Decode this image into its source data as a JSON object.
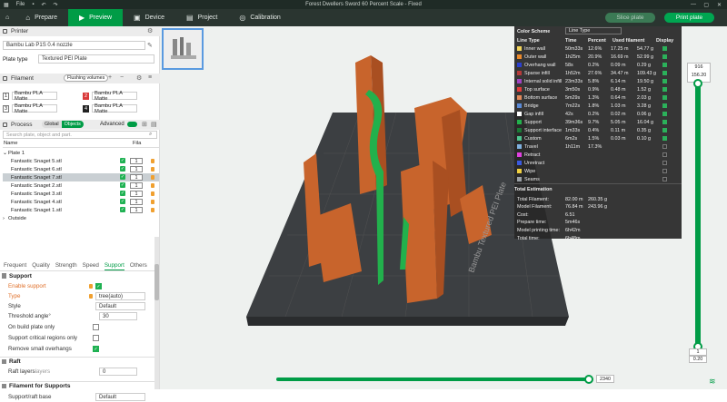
{
  "window": {
    "menu": "File",
    "title": "Forest Dwellers Sword 60 Percent Scale - Fixed"
  },
  "tabs": [
    {
      "icon": "⌂",
      "label": "Prepare"
    },
    {
      "icon": "▶",
      "label": "Preview"
    },
    {
      "icon": "▣",
      "label": "Device"
    },
    {
      "icon": "▤",
      "label": "Project"
    },
    {
      "icon": "◎",
      "label": "Calibration"
    }
  ],
  "actions": {
    "slice": "Slice plate",
    "print": "Print plate"
  },
  "printer": {
    "section": "Printer",
    "name": "Bambu Lab P1S 0.4 nozzle",
    "plate_type_label": "Plate type",
    "plate_type": "Textured PEI Plate"
  },
  "filament": {
    "section": "Filament",
    "flushing": "Flushing volumes",
    "slots": [
      {
        "n": "1",
        "name": "Bambu PLA Matte",
        "style": "white"
      },
      {
        "n": "2",
        "name": "Bambu PLA Matte",
        "style": "red"
      },
      {
        "n": "3",
        "name": "Bambu PLA Matte",
        "style": "white"
      },
      {
        "n": "4",
        "name": "Bambu PLA Matte",
        "style": "blk"
      }
    ]
  },
  "process": {
    "section": "Process",
    "global": "Global",
    "objects": "Objects",
    "advanced": "Advanced",
    "search_placeholder": "Search plate, object and part.",
    "col_name": "Name",
    "col_fila": "Fila"
  },
  "tree": {
    "plate": "Plate 1",
    "items": [
      {
        "name": "Fantastic Snaget 5.stl",
        "fila": "1"
      },
      {
        "name": "Fantastic Snaget 6.stl",
        "fila": "1"
      },
      {
        "name": "Fantastic Snaget 7.stl",
        "fila": "1"
      },
      {
        "name": "Fantastic Snaget 2.stl",
        "fila": "1"
      },
      {
        "name": "Fantastic Snaget 3.stl",
        "fila": "1"
      },
      {
        "name": "Fantastic Snaget 4.stl",
        "fila": "1"
      },
      {
        "name": "Fantastic Snaget 1.stl",
        "fila": "1"
      }
    ],
    "outside": "Outside"
  },
  "param_tabs": [
    "Frequent",
    "Quality",
    "Strength",
    "Speed",
    "Support",
    "Others"
  ],
  "support": {
    "header": "Support",
    "enable": "Enable support",
    "type_label": "Type",
    "type_value": "tree(auto)",
    "style_label": "Style",
    "style_value": "Default",
    "threshold_label": "Threshold angle",
    "threshold_value": "30",
    "threshold_unit": "°",
    "on_build_plate": "On build plate only",
    "critical": "Support critical regions only",
    "remove_small": "Remove small overhangs"
  },
  "raft": {
    "header": "Raft",
    "layers_label": "Raft layers",
    "layers_value": "0",
    "layers_unit": "layers"
  },
  "filament_support": {
    "header": "Filament for Supports",
    "base_label": "Support/raft base",
    "base_value": "Default"
  },
  "legend": {
    "title": "Color Scheme",
    "scheme": "Line Type",
    "headers": [
      "Line Type",
      "Time",
      "Percent",
      "Used filament",
      "Display"
    ],
    "rows": [
      {
        "name": "Inner wall",
        "color": "#f3d55a",
        "time": "50m33s",
        "pct": "12.6%",
        "len": "17.25 m",
        "wt": "54.77 g",
        "on": true
      },
      {
        "name": "Outer wall",
        "color": "#ec8a2b",
        "time": "1h25m",
        "pct": "20.9%",
        "len": "16.69 m",
        "wt": "52.99 g",
        "on": true
      },
      {
        "name": "Overhang wall",
        "color": "#2b3fd0",
        "time": "58s",
        "pct": "0.2%",
        "len": "0.09 m",
        "wt": "0.29 g",
        "on": true
      },
      {
        "name": "Sparse infill",
        "color": "#b53a3a",
        "time": "1h52m",
        "pct": "27.6%",
        "len": "34.47 m",
        "wt": "109.43 g",
        "on": true
      },
      {
        "name": "Internal solid infill",
        "color": "#a143c2",
        "time": "23m33s",
        "pct": "5.8%",
        "len": "6.14 m",
        "wt": "19.50 g",
        "on": true
      },
      {
        "name": "Top surface",
        "color": "#e23b3b",
        "time": "3m50s",
        "pct": "0.9%",
        "len": "0.48 m",
        "wt": "1.52 g",
        "on": true
      },
      {
        "name": "Bottom surface",
        "color": "#e38a5b",
        "time": "5m29s",
        "pct": "1.3%",
        "len": "0.64 m",
        "wt": "2.03 g",
        "on": true
      },
      {
        "name": "Bridge",
        "color": "#5a8ad6",
        "time": "7m22s",
        "pct": "1.8%",
        "len": "1.03 m",
        "wt": "3.28 g",
        "on": true
      },
      {
        "name": "Gap infill",
        "color": "#ffffff",
        "time": "42s",
        "pct": "0.2%",
        "len": "0.02 m",
        "wt": "0.06 g",
        "on": true
      },
      {
        "name": "Support",
        "color": "#22b14c",
        "time": "39m36s",
        "pct": "9.7%",
        "len": "5.05 m",
        "wt": "16.04 g",
        "on": true
      },
      {
        "name": "Support interface",
        "color": "#1a7a35",
        "time": "1m33s",
        "pct": "0.4%",
        "len": "0.11 m",
        "wt": "0.35 g",
        "on": true
      },
      {
        "name": "Custom",
        "color": "#4ec58f",
        "time": "6m2s",
        "pct": "1.5%",
        "len": "0.03 m",
        "wt": "0.10 g",
        "on": true
      },
      {
        "name": "Travel",
        "color": "#7fb1e0",
        "time": "1h11m",
        "pct": "17.3%",
        "len": "",
        "wt": "",
        "on": false
      },
      {
        "name": "Retract",
        "color": "#e040e0",
        "time": "",
        "pct": "",
        "len": "",
        "wt": "",
        "on": false
      },
      {
        "name": "Unretract",
        "color": "#3a5ae0",
        "time": "",
        "pct": "",
        "len": "",
        "wt": "",
        "on": false
      },
      {
        "name": "Wipe",
        "color": "#f0d040",
        "time": "",
        "pct": "",
        "len": "",
        "wt": "",
        "on": false
      },
      {
        "name": "Seams",
        "color": "#9aa0a6",
        "time": "",
        "pct": "",
        "len": "",
        "wt": "",
        "on": false
      }
    ]
  },
  "estimation": {
    "title": "Total Estimation",
    "rows": [
      {
        "label": "Total Filament:",
        "v1": "82.00 m",
        "v2": "260.35 g"
      },
      {
        "label": "Model Filament:",
        "v1": "76.84 m",
        "v2": "243.96 g"
      },
      {
        "label": "Cost:",
        "v1": "6.51",
        "v2": ""
      },
      {
        "label": "Prepare time:",
        "v1": "5m46s",
        "v2": ""
      },
      {
        "label": "Model printing time:",
        "v1": "6h42m",
        "v2": ""
      },
      {
        "label": "Total time:",
        "v1": "6h48m",
        "v2": ""
      }
    ]
  },
  "layer_slider": {
    "top_layer": "916",
    "top_height": "156.20",
    "bottom_layer": "1",
    "bottom_height": "0.20"
  },
  "move_slider": {
    "value": "2340"
  },
  "plate_label": "Bambu Textured PEI Plate",
  "colors": {
    "accent": "#009c46",
    "brown": "#c8642c",
    "support": "#1fb152"
  }
}
